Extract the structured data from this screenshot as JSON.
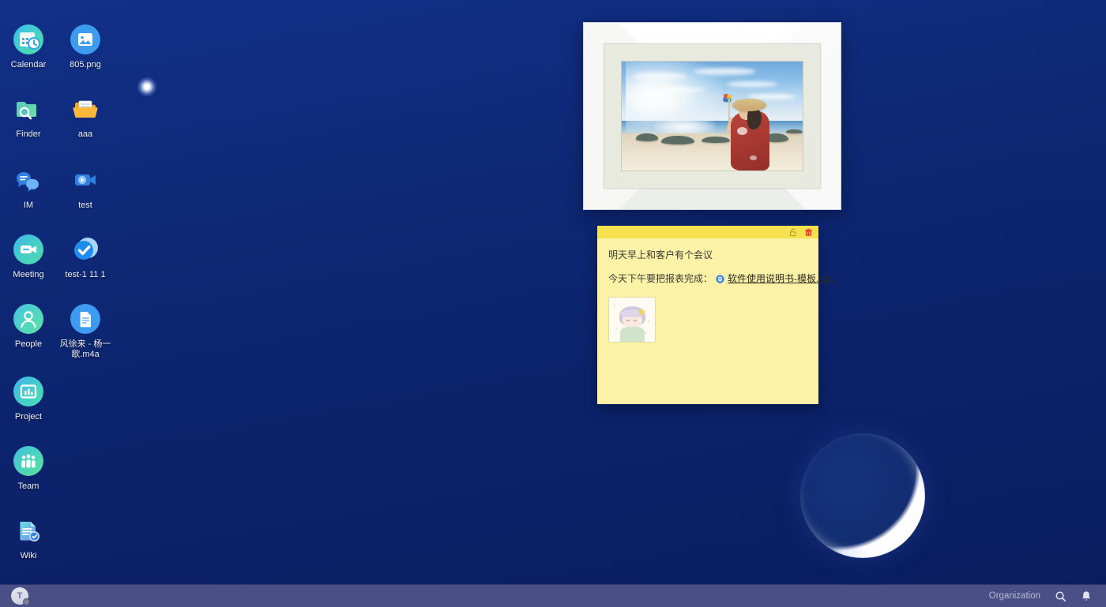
{
  "desktop": {
    "background_color": "#0e2875",
    "star": {
      "name": "star-light"
    },
    "moon": {
      "name": "crescent-moon"
    }
  },
  "icons": [
    {
      "label": "Calendar",
      "icon": "calendar-icon",
      "col": 0,
      "row": 0
    },
    {
      "label": "805.png",
      "icon": "image-file-icon",
      "col": 1,
      "row": 0
    },
    {
      "label": "Finder",
      "icon": "finder-icon",
      "col": 0,
      "row": 1
    },
    {
      "label": "aaa",
      "icon": "folder-icon",
      "col": 1,
      "row": 1
    },
    {
      "label": "IM",
      "icon": "chat-icon",
      "col": 0,
      "row": 2
    },
    {
      "label": "test",
      "icon": "video-icon",
      "col": 1,
      "row": 2
    },
    {
      "label": "Meeting",
      "icon": "meeting-icon",
      "col": 0,
      "row": 3
    },
    {
      "label": "test-1 11 1",
      "icon": "check-icon",
      "col": 1,
      "row": 3
    },
    {
      "label": "People",
      "icon": "people-icon",
      "col": 0,
      "row": 4
    },
    {
      "label": "风徐来 - 杨一歌.m4a",
      "icon": "doc-file-icon",
      "col": 1,
      "row": 4
    },
    {
      "label": "Project",
      "icon": "project-icon",
      "col": 0,
      "row": 5
    },
    {
      "label": "Team",
      "icon": "team-icon",
      "col": 0,
      "row": 6
    },
    {
      "label": "Wiki",
      "icon": "wiki-icon",
      "col": 0,
      "row": 7
    }
  ],
  "photo_frame": {
    "name": "picture-frame-widget",
    "frame_color": "#ffffff",
    "mat_color": "#e8eadf",
    "photo_description": "woman-on-beach-with-pinwheel"
  },
  "sticky_note": {
    "name": "sticky-note-widget",
    "background_color": "#fbf2a8",
    "header_color": "#f5e24e",
    "lock_icon": "unlock-icon",
    "delete_icon": "trash-icon",
    "line1": "明天早上和客户有个会议",
    "line2": "今天下午要把报表完成：",
    "attachment_icon": "doc-icon",
    "attachment_label": "软件使用说明书-模板.doc",
    "thumbnail": "anime-girl-thumbnail"
  },
  "taskbar": {
    "background_color": "#4a4f86",
    "avatar_initial": "T",
    "organization_label": "Organization",
    "search_icon": "search-icon",
    "notification_icon": "bell-icon"
  }
}
